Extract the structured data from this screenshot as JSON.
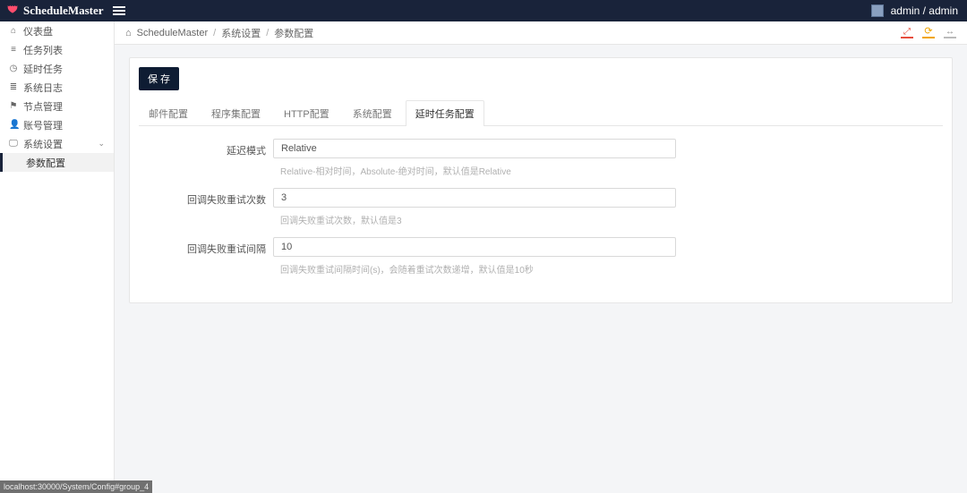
{
  "header": {
    "brand": "ScheduleMaster",
    "user_label": "admin / admin"
  },
  "sidebar": {
    "items": [
      {
        "icon": "home",
        "label": "仪表盘"
      },
      {
        "icon": "list",
        "label": "任务列表"
      },
      {
        "icon": "clock",
        "label": "延时任务"
      },
      {
        "icon": "lines",
        "label": "系统日志"
      },
      {
        "icon": "nodes",
        "label": "节点管理"
      },
      {
        "icon": "user",
        "label": "账号管理"
      },
      {
        "icon": "monitor",
        "label": "系统设置",
        "expandable": true
      }
    ],
    "sub_item": "参数配置"
  },
  "breadcrumb": {
    "root": "ScheduleMaster",
    "level1": "系统设置",
    "level2": "参数配置"
  },
  "panel": {
    "save_label": "保 存",
    "tabs": [
      "邮件配置",
      "程序集配置",
      "HTTP配置",
      "系统配置",
      "延时任务配置"
    ],
    "active_tab_index": 4,
    "fields": [
      {
        "label": "延迟模式",
        "value": "Relative",
        "help": "Relative-相对时间，Absolute-绝对时间，默认值是Relative"
      },
      {
        "label": "回调失败重试次数",
        "value": "3",
        "help": "回调失败重试次数，默认值是3"
      },
      {
        "label": "回调失败重试间隔",
        "value": "10",
        "help": "回调失败重试间隔时间(s)，会随着重试次数递增，默认值是10秒"
      }
    ]
  },
  "statusbar": {
    "text": "localhost:30000/System/Config#group_4"
  }
}
